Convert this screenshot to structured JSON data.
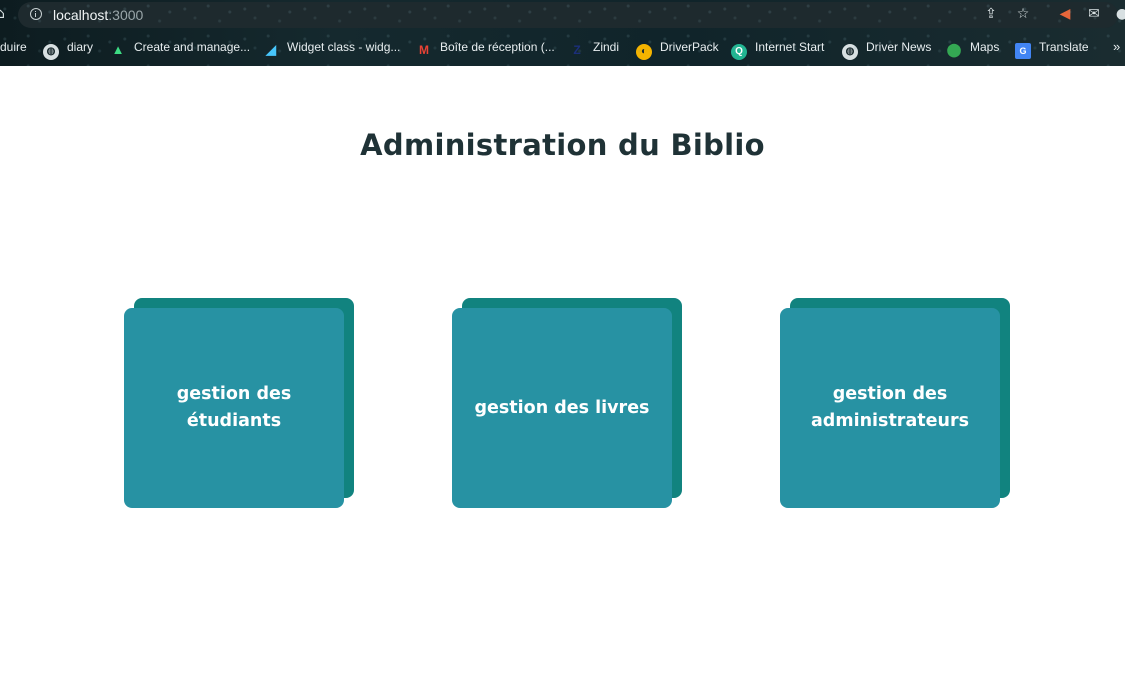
{
  "browser": {
    "url_host": "localhost",
    "url_port": ":3000",
    "address_icons": [
      "share-icon",
      "star-icon",
      "extension-icon",
      "mail-icon",
      "profile-icon"
    ],
    "bookmarks": [
      {
        "label": "duire",
        "icon": "none"
      },
      {
        "label": "diary",
        "icon": "globe-icon"
      },
      {
        "label": "Create and manage...",
        "icon": "android-icon"
      },
      {
        "label": "Widget class - widg...",
        "icon": "flutter-icon"
      },
      {
        "label": "Boîte de réception (...",
        "icon": "gmail-icon"
      },
      {
        "label": "Zindi",
        "icon": "zindi-icon"
      },
      {
        "label": "DriverPack",
        "icon": "driverpack-icon"
      },
      {
        "label": "Internet Start",
        "icon": "internet-start-icon"
      },
      {
        "label": "Driver News",
        "icon": "globe-icon"
      },
      {
        "label": "Maps",
        "icon": "maps-icon"
      },
      {
        "label": "Translate",
        "icon": "translate-icon"
      }
    ],
    "more_bookmarks": "»"
  },
  "page": {
    "title": "Administration du Biblio",
    "cards": [
      {
        "label": "gestion des étudiants"
      },
      {
        "label": "gestion des livres"
      },
      {
        "label": "gestion des administrateurs"
      }
    ]
  },
  "colors": {
    "card_front": "#2792a3",
    "card_back": "#11837f",
    "title": "#1f3236"
  }
}
